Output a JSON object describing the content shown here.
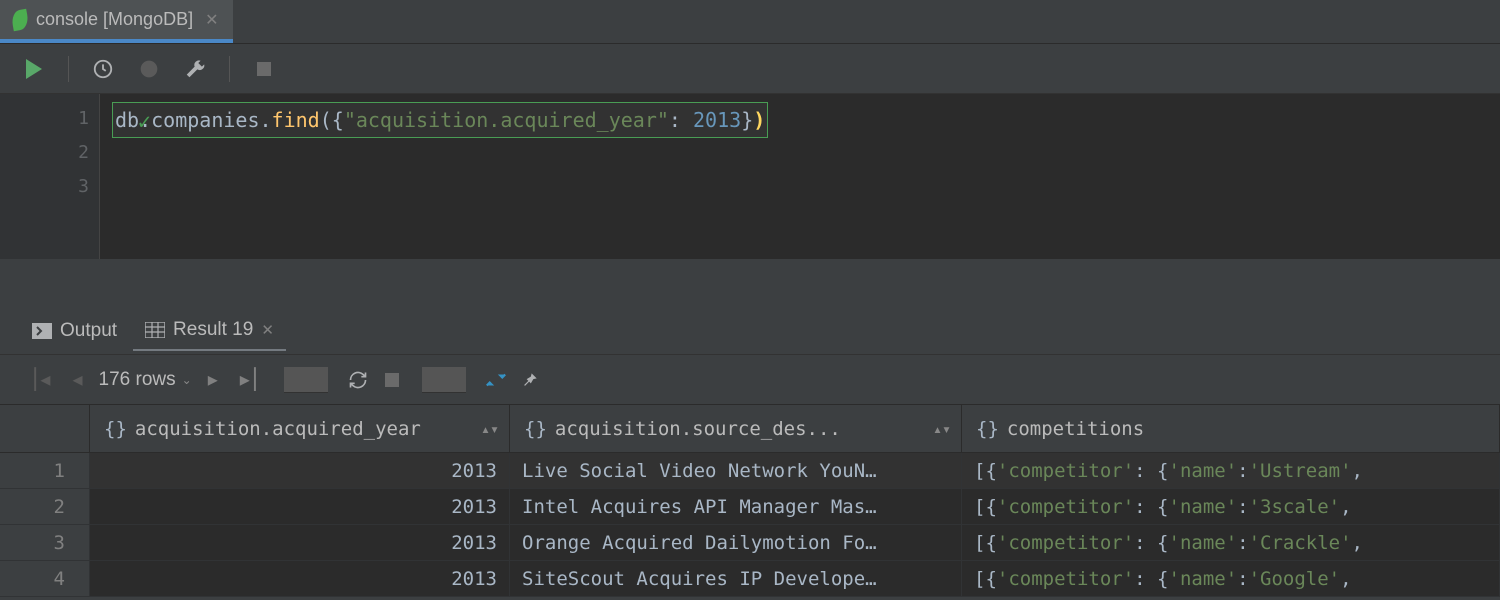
{
  "tab": {
    "label": "console [MongoDB]",
    "icon": "mongodb-leaf-icon"
  },
  "toolbar": {
    "run": "run-icon",
    "history": "history-icon",
    "param": "param-icon",
    "settings": "wrench-icon",
    "stop": "stop-icon"
  },
  "editor": {
    "lines": [
      "1",
      "2",
      "3"
    ],
    "code": {
      "db": "db",
      "coll": ".companies.",
      "fn": "find",
      "open": "(",
      "brace_open": "{",
      "key": "\"acquisition.acquired_year\"",
      "colon": ": ",
      "value": "2013",
      "brace_close": "}",
      "close": ")"
    }
  },
  "panels": {
    "output_label": "Output",
    "result_label": "Result 19"
  },
  "result_toolbar": {
    "rowcount": "176 rows"
  },
  "columns": [
    {
      "label": "acquisition.acquired_year"
    },
    {
      "label": "acquisition.source_des..."
    },
    {
      "label": "competitions"
    }
  ],
  "rows": [
    {
      "n": "1",
      "year": "2013",
      "desc": "Live Social Video Network YouN…",
      "comp_name": "'Ustream'"
    },
    {
      "n": "2",
      "year": "2013",
      "desc": "Intel Acquires API Manager Mas…",
      "comp_name": "'3scale'"
    },
    {
      "n": "3",
      "year": "2013",
      "desc": "Orange Acquired Dailymotion Fo…",
      "comp_name": "'Crackle'"
    },
    {
      "n": "4",
      "year": "2013",
      "desc": "SiteScout Acquires IP Develope…",
      "comp_name": "'Google'"
    }
  ],
  "comp_tmpl": {
    "pre": "[{",
    "k1": "'competitor'",
    "mid": ": {",
    "k2": "'name'",
    "sep": ": ",
    "post": ","
  }
}
